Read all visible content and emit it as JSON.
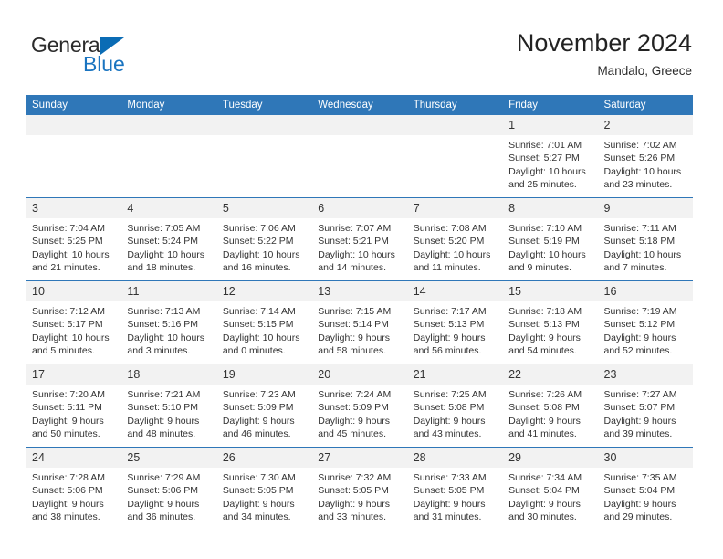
{
  "brand": {
    "name_part1": "General",
    "name_part2": "Blue",
    "logo_icon": "blue-triangle-logo",
    "accent_color": "#1a74c0"
  },
  "header": {
    "title": "November 2024",
    "location": "Mandalo, Greece"
  },
  "theme": {
    "header_blue": "#2f77b8",
    "daynum_bg": "#f2f2f2",
    "text": "#333333"
  },
  "calendar": {
    "weekday_headers": [
      "Sunday",
      "Monday",
      "Tuesday",
      "Wednesday",
      "Thursday",
      "Friday",
      "Saturday"
    ],
    "labels": {
      "sunrise": "Sunrise:",
      "sunset": "Sunset:",
      "daylight": "Daylight:"
    },
    "weeks": [
      [
        {
          "day": "",
          "blank": true
        },
        {
          "day": "",
          "blank": true
        },
        {
          "day": "",
          "blank": true
        },
        {
          "day": "",
          "blank": true
        },
        {
          "day": "",
          "blank": true
        },
        {
          "day": "1",
          "sunrise": "Sunrise: 7:01 AM",
          "sunset": "Sunset: 5:27 PM",
          "daylight1": "Daylight: 10 hours",
          "daylight2": "and 25 minutes."
        },
        {
          "day": "2",
          "sunrise": "Sunrise: 7:02 AM",
          "sunset": "Sunset: 5:26 PM",
          "daylight1": "Daylight: 10 hours",
          "daylight2": "and 23 minutes."
        }
      ],
      [
        {
          "day": "3",
          "sunrise": "Sunrise: 7:04 AM",
          "sunset": "Sunset: 5:25 PM",
          "daylight1": "Daylight: 10 hours",
          "daylight2": "and 21 minutes."
        },
        {
          "day": "4",
          "sunrise": "Sunrise: 7:05 AM",
          "sunset": "Sunset: 5:24 PM",
          "daylight1": "Daylight: 10 hours",
          "daylight2": "and 18 minutes."
        },
        {
          "day": "5",
          "sunrise": "Sunrise: 7:06 AM",
          "sunset": "Sunset: 5:22 PM",
          "daylight1": "Daylight: 10 hours",
          "daylight2": "and 16 minutes."
        },
        {
          "day": "6",
          "sunrise": "Sunrise: 7:07 AM",
          "sunset": "Sunset: 5:21 PM",
          "daylight1": "Daylight: 10 hours",
          "daylight2": "and 14 minutes."
        },
        {
          "day": "7",
          "sunrise": "Sunrise: 7:08 AM",
          "sunset": "Sunset: 5:20 PM",
          "daylight1": "Daylight: 10 hours",
          "daylight2": "and 11 minutes."
        },
        {
          "day": "8",
          "sunrise": "Sunrise: 7:10 AM",
          "sunset": "Sunset: 5:19 PM",
          "daylight1": "Daylight: 10 hours",
          "daylight2": "and 9 minutes."
        },
        {
          "day": "9",
          "sunrise": "Sunrise: 7:11 AM",
          "sunset": "Sunset: 5:18 PM",
          "daylight1": "Daylight: 10 hours",
          "daylight2": "and 7 minutes."
        }
      ],
      [
        {
          "day": "10",
          "sunrise": "Sunrise: 7:12 AM",
          "sunset": "Sunset: 5:17 PM",
          "daylight1": "Daylight: 10 hours",
          "daylight2": "and 5 minutes."
        },
        {
          "day": "11",
          "sunrise": "Sunrise: 7:13 AM",
          "sunset": "Sunset: 5:16 PM",
          "daylight1": "Daylight: 10 hours",
          "daylight2": "and 3 minutes."
        },
        {
          "day": "12",
          "sunrise": "Sunrise: 7:14 AM",
          "sunset": "Sunset: 5:15 PM",
          "daylight1": "Daylight: 10 hours",
          "daylight2": "and 0 minutes."
        },
        {
          "day": "13",
          "sunrise": "Sunrise: 7:15 AM",
          "sunset": "Sunset: 5:14 PM",
          "daylight1": "Daylight: 9 hours",
          "daylight2": "and 58 minutes."
        },
        {
          "day": "14",
          "sunrise": "Sunrise: 7:17 AM",
          "sunset": "Sunset: 5:13 PM",
          "daylight1": "Daylight: 9 hours",
          "daylight2": "and 56 minutes."
        },
        {
          "day": "15",
          "sunrise": "Sunrise: 7:18 AM",
          "sunset": "Sunset: 5:13 PM",
          "daylight1": "Daylight: 9 hours",
          "daylight2": "and 54 minutes."
        },
        {
          "day": "16",
          "sunrise": "Sunrise: 7:19 AM",
          "sunset": "Sunset: 5:12 PM",
          "daylight1": "Daylight: 9 hours",
          "daylight2": "and 52 minutes."
        }
      ],
      [
        {
          "day": "17",
          "sunrise": "Sunrise: 7:20 AM",
          "sunset": "Sunset: 5:11 PM",
          "daylight1": "Daylight: 9 hours",
          "daylight2": "and 50 minutes."
        },
        {
          "day": "18",
          "sunrise": "Sunrise: 7:21 AM",
          "sunset": "Sunset: 5:10 PM",
          "daylight1": "Daylight: 9 hours",
          "daylight2": "and 48 minutes."
        },
        {
          "day": "19",
          "sunrise": "Sunrise: 7:23 AM",
          "sunset": "Sunset: 5:09 PM",
          "daylight1": "Daylight: 9 hours",
          "daylight2": "and 46 minutes."
        },
        {
          "day": "20",
          "sunrise": "Sunrise: 7:24 AM",
          "sunset": "Sunset: 5:09 PM",
          "daylight1": "Daylight: 9 hours",
          "daylight2": "and 45 minutes."
        },
        {
          "day": "21",
          "sunrise": "Sunrise: 7:25 AM",
          "sunset": "Sunset: 5:08 PM",
          "daylight1": "Daylight: 9 hours",
          "daylight2": "and 43 minutes."
        },
        {
          "day": "22",
          "sunrise": "Sunrise: 7:26 AM",
          "sunset": "Sunset: 5:08 PM",
          "daylight1": "Daylight: 9 hours",
          "daylight2": "and 41 minutes."
        },
        {
          "day": "23",
          "sunrise": "Sunrise: 7:27 AM",
          "sunset": "Sunset: 5:07 PM",
          "daylight1": "Daylight: 9 hours",
          "daylight2": "and 39 minutes."
        }
      ],
      [
        {
          "day": "24",
          "sunrise": "Sunrise: 7:28 AM",
          "sunset": "Sunset: 5:06 PM",
          "daylight1": "Daylight: 9 hours",
          "daylight2": "and 38 minutes."
        },
        {
          "day": "25",
          "sunrise": "Sunrise: 7:29 AM",
          "sunset": "Sunset: 5:06 PM",
          "daylight1": "Daylight: 9 hours",
          "daylight2": "and 36 minutes."
        },
        {
          "day": "26",
          "sunrise": "Sunrise: 7:30 AM",
          "sunset": "Sunset: 5:05 PM",
          "daylight1": "Daylight: 9 hours",
          "daylight2": "and 34 minutes."
        },
        {
          "day": "27",
          "sunrise": "Sunrise: 7:32 AM",
          "sunset": "Sunset: 5:05 PM",
          "daylight1": "Daylight: 9 hours",
          "daylight2": "and 33 minutes."
        },
        {
          "day": "28",
          "sunrise": "Sunrise: 7:33 AM",
          "sunset": "Sunset: 5:05 PM",
          "daylight1": "Daylight: 9 hours",
          "daylight2": "and 31 minutes."
        },
        {
          "day": "29",
          "sunrise": "Sunrise: 7:34 AM",
          "sunset": "Sunset: 5:04 PM",
          "daylight1": "Daylight: 9 hours",
          "daylight2": "and 30 minutes."
        },
        {
          "day": "30",
          "sunrise": "Sunrise: 7:35 AM",
          "sunset": "Sunset: 5:04 PM",
          "daylight1": "Daylight: 9 hours",
          "daylight2": "and 29 minutes."
        }
      ]
    ]
  }
}
